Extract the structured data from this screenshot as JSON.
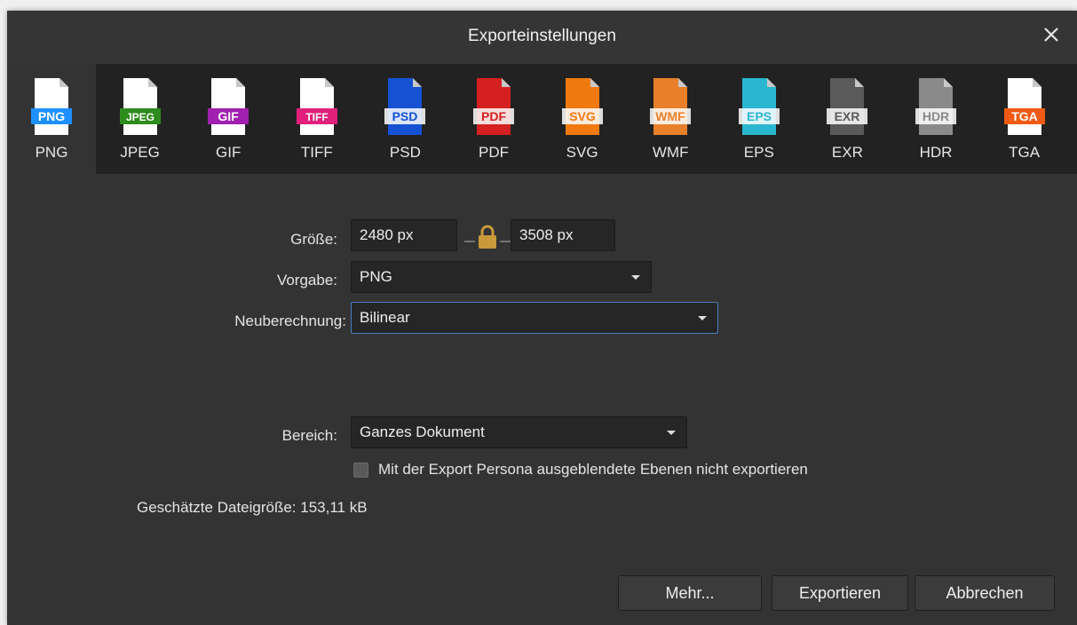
{
  "window": {
    "title": "Exporteinstellungen"
  },
  "formats": [
    {
      "name": "png",
      "badge": "PNG",
      "label": "PNG",
      "color": "#1e90ff",
      "doc": "#ffffff",
      "selected": true
    },
    {
      "name": "jpeg",
      "badge": "JPEG",
      "label": "JPEG",
      "color": "#2e8b1e",
      "doc": "#ffffff"
    },
    {
      "name": "gif",
      "badge": "GIF",
      "label": "GIF",
      "color": "#a020b0",
      "doc": "#ffffff"
    },
    {
      "name": "tiff",
      "badge": "TIFF",
      "label": "TIFF",
      "color": "#e0207a",
      "doc": "#ffffff"
    },
    {
      "name": "psd",
      "badge": "PSD",
      "label": "PSD",
      "color": "#ffffff",
      "doc": "#1553d4"
    },
    {
      "name": "pdf",
      "badge": "PDF",
      "label": "PDF",
      "color": "#ffffff",
      "doc": "#d42020"
    },
    {
      "name": "svg",
      "badge": "SVG",
      "label": "SVG",
      "color": "#ffffff",
      "doc": "#f07a10"
    },
    {
      "name": "wmf",
      "badge": "WMF",
      "label": "WMF",
      "color": "#ffffff",
      "doc": "#e8802a"
    },
    {
      "name": "eps",
      "badge": "EPS",
      "label": "EPS",
      "color": "#ffffff",
      "doc": "#2ab6d0"
    },
    {
      "name": "exr",
      "badge": "EXR",
      "label": "EXR",
      "color": "#ffffff",
      "doc": "#5a5a5a"
    },
    {
      "name": "hdr",
      "badge": "HDR",
      "label": "HDR",
      "color": "#ffffff",
      "doc": "#8a8a8a"
    },
    {
      "name": "tga",
      "badge": "TGA",
      "label": "TGA",
      "color": "#f05a14",
      "doc": "#ffffff"
    }
  ],
  "settings": {
    "size_label": "Größe:",
    "width_value": "2480 px",
    "height_value": "3508 px",
    "preset_label": "Vorgabe:",
    "preset_value": "PNG",
    "resample_label": "Neuberechnung:",
    "resample_value": "Bilinear",
    "area_label": "Bereich:",
    "area_value": "Ganzes Dokument",
    "hidden_layers_label": "Mit der Export Persona ausgeblendete Ebenen nicht exportieren",
    "hidden_layers_checked": false,
    "filesize_text": "Geschätzte Dateigröße: 153,11 kB"
  },
  "buttons": {
    "more": "Mehr...",
    "export": "Exportieren",
    "cancel": "Abbrechen"
  },
  "colors": {
    "focus_border": "#4a7fbf",
    "lock": "#c89a3a"
  }
}
